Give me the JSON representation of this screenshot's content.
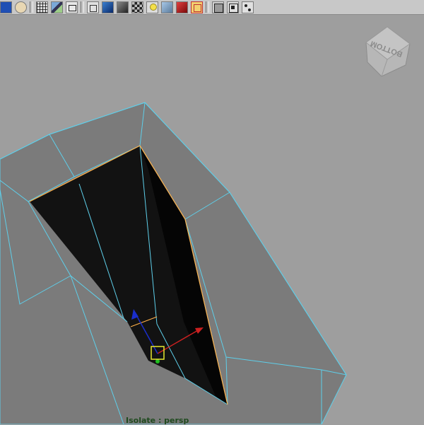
{
  "toolbar": {
    "groups": [
      [
        "camera-icon",
        "sphere-icon"
      ],
      [
        "grid-icon",
        "image-plane-icon",
        "resolution-gate-icon"
      ],
      [
        "wireframe-cube-icon",
        "smooth-shade-icon",
        "flat-shade-icon",
        "texture-icon",
        "lighting-icon",
        "xray-icon",
        "render-icon",
        "frame-icon"
      ],
      [
        "wire-on-shaded-icon",
        "isolate-select-icon",
        "node-editor-icon"
      ]
    ]
  },
  "viewport": {
    "background_color": "#9e9e9e",
    "mesh_face_color": "#7b7b7b",
    "wire_color": "#5ecfea",
    "hole_color": "#121212",
    "selected_edge_color": "#ffb04a",
    "view_cube_label": "BOTTOM",
    "hud_label": "Isolate : persp"
  },
  "manipulator": {
    "x_axis_color": "#cc2020",
    "y_axis_color": "#20c020",
    "z_axis_color": "#1a2ecc",
    "center_color": "#e8e830"
  }
}
